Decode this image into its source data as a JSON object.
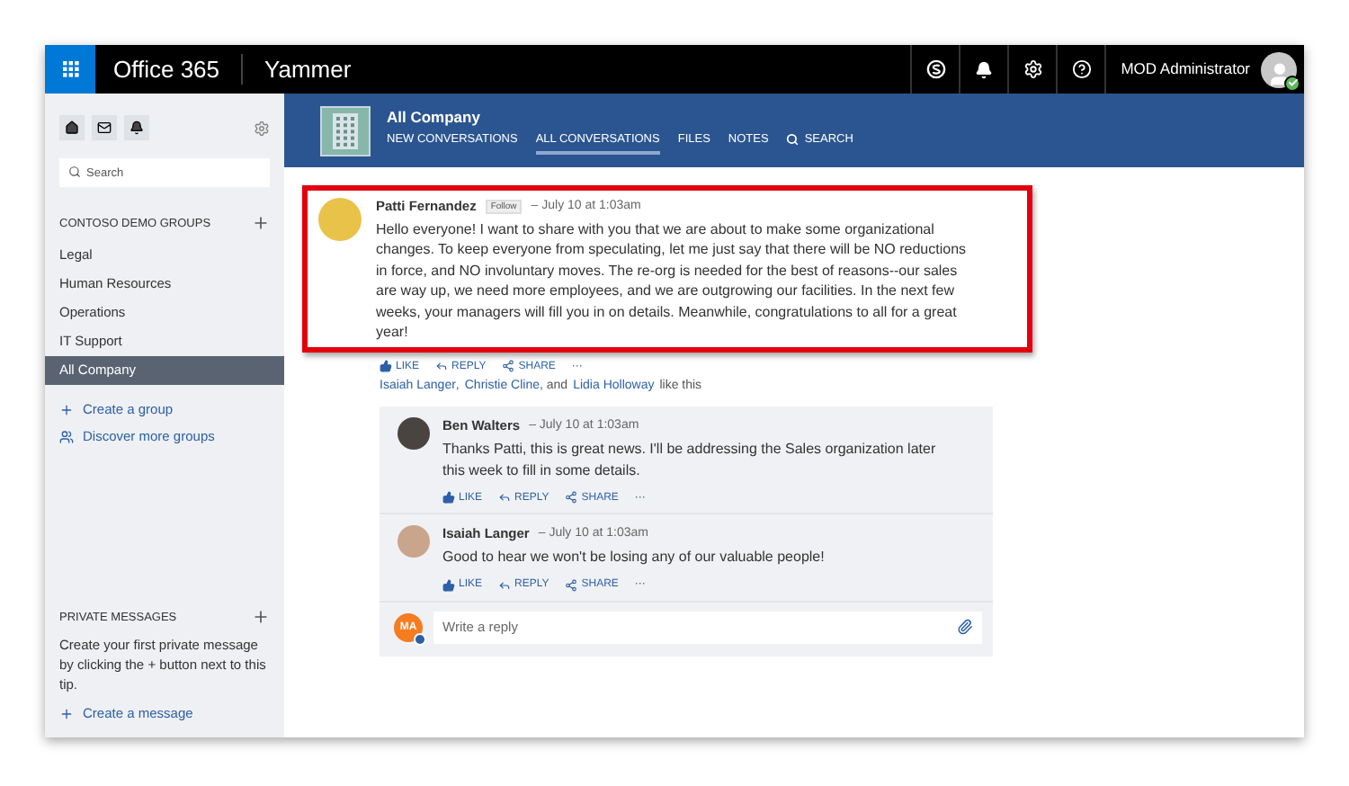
{
  "topbar": {
    "brand": "Office 365",
    "app": "Yammer",
    "user": "MOD Administrator",
    "user_online": true
  },
  "sidebar": {
    "search": {
      "placeholder": "Search"
    },
    "groups_heading": "CONTOSO DEMO GROUPS",
    "groups": [
      {
        "label": "Legal",
        "selected": false
      },
      {
        "label": "Human Resources",
        "selected": false
      },
      {
        "label": "Operations",
        "selected": false
      },
      {
        "label": "IT Support",
        "selected": false
      },
      {
        "label": "All Company",
        "selected": true
      }
    ],
    "links": [
      {
        "label": "Create a group",
        "kind": "add"
      },
      {
        "label": "Discover more groups",
        "kind": "people"
      }
    ],
    "private_heading": "PRIVATE MESSAGES",
    "private_tip": "Create your first private message by clicking the + button next to this tip.",
    "private_link": {
      "label": "Create a message",
      "kind": "add"
    }
  },
  "group": {
    "name": "All Company",
    "tabs": [
      {
        "label": "NEW CONVERSATIONS",
        "selected": false,
        "kind": "text"
      },
      {
        "label": "ALL CONVERSATIONS",
        "selected": true,
        "kind": "text"
      },
      {
        "label": "FILES",
        "selected": false,
        "kind": "text"
      },
      {
        "label": "NOTES",
        "selected": false,
        "kind": "text"
      },
      {
        "label": "SEARCH",
        "selected": false,
        "kind": "search"
      }
    ]
  },
  "post": {
    "author": "Patti Fernandez",
    "follow": "Follow",
    "time": "– July 10 at 1:03am",
    "highlighted": true,
    "body": "Hello everyone! I want to share with you that we are about to make some organizational changes. To keep everyone from speculating, let me just say that there will be NO reductions in force, and NO involuntary moves. The re-org is needed for the best of reasons--our sales are way up, we need more employees, and we are outgrowing our facilities. In the next few weeks, your managers will fill you in on details. Meanwhile, congratulations to all for a great year!",
    "actions": [
      {
        "label": "LIKE",
        "kind": "like"
      },
      {
        "label": "REPLY",
        "kind": "reply"
      },
      {
        "label": "SHARE",
        "kind": "share"
      },
      {
        "label": "···",
        "kind": "more"
      }
    ],
    "likes": [
      {
        "text": "Isaiah Langer",
        "kind": "link"
      },
      {
        "text": ",",
        "kind": "plain"
      },
      {
        "text": "Christie Cline",
        "kind": "link"
      },
      {
        "text": ", and",
        "kind": "plain"
      },
      {
        "text": "Lidia Holloway",
        "kind": "link"
      },
      {
        "text": "like this",
        "kind": "plain"
      }
    ]
  },
  "replies": [
    {
      "author": "Ben Walters",
      "time": "– July 10 at 1:03am",
      "body": "Thanks Patti, this is great news. I'll be addressing the Sales organization later this week to fill in some details.",
      "actions": [
        {
          "label": "LIKE",
          "kind": "like"
        },
        {
          "label": "REPLY",
          "kind": "reply"
        },
        {
          "label": "SHARE",
          "kind": "share"
        },
        {
          "label": "···",
          "kind": "more"
        }
      ]
    },
    {
      "author": "Isaiah Langer",
      "time": "– July 10 at 1:03am",
      "body": "Good to hear we won't be losing any of our valuable people!",
      "actions": [
        {
          "label": "LIKE",
          "kind": "like"
        },
        {
          "label": "REPLY",
          "kind": "reply"
        },
        {
          "label": "SHARE",
          "kind": "share"
        },
        {
          "label": "···",
          "kind": "more"
        }
      ]
    }
  ],
  "reply_box": {
    "initials": "MA",
    "placeholder": "Write a reply"
  }
}
